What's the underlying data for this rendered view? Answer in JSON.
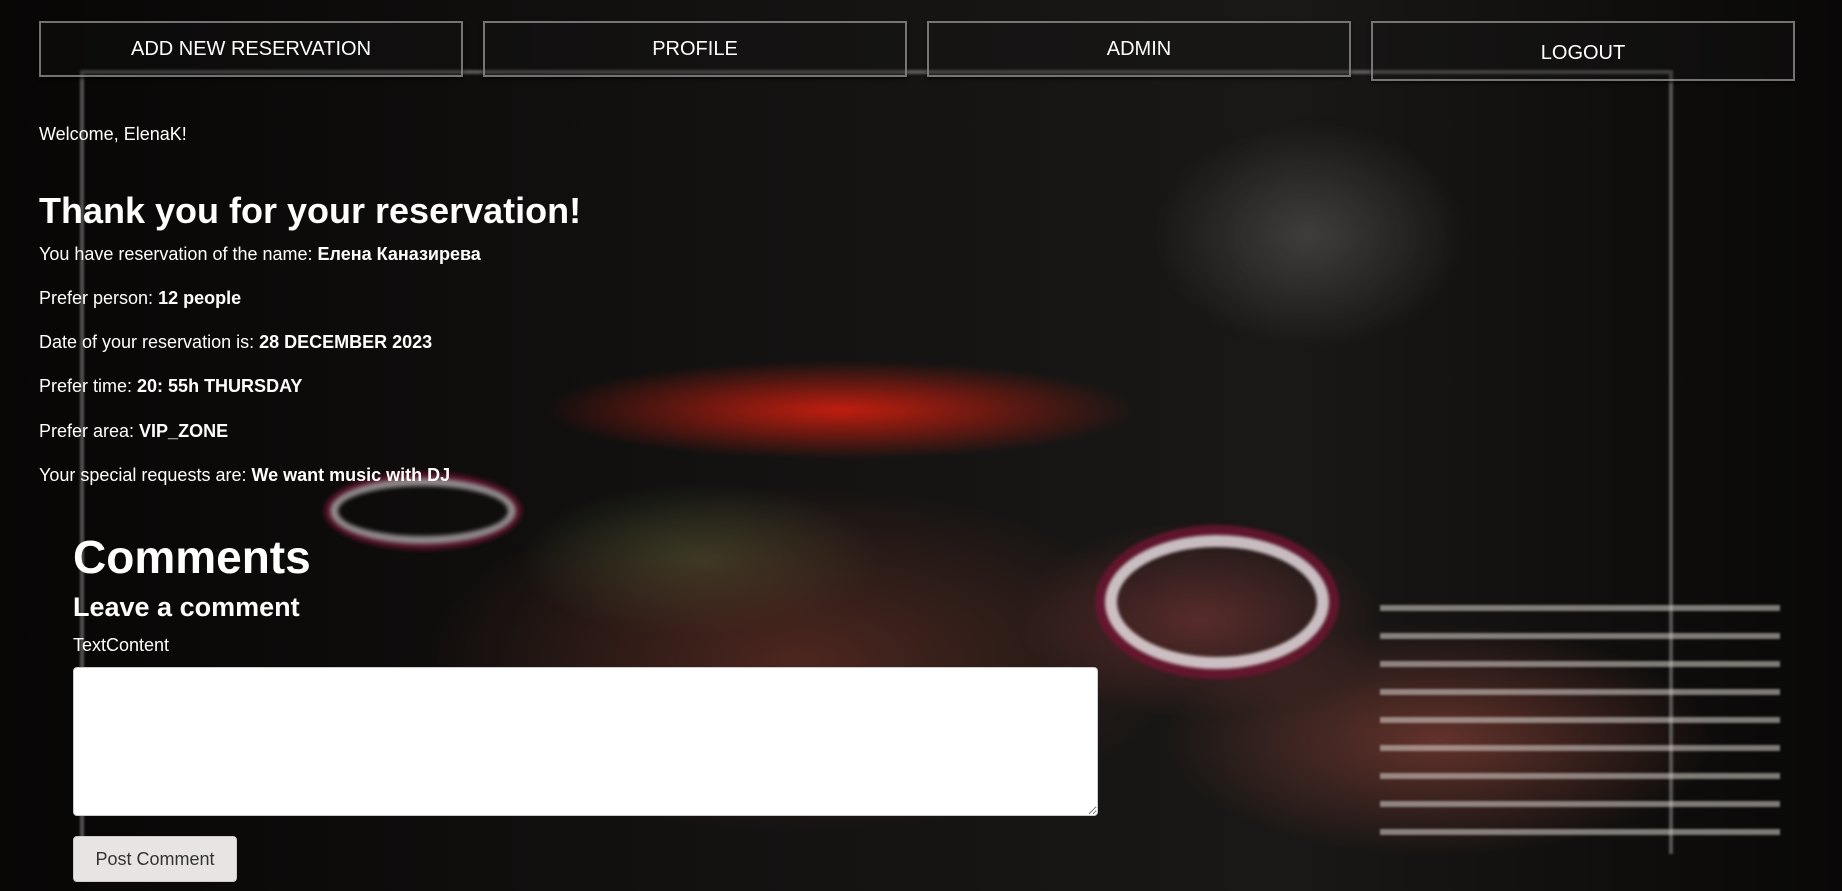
{
  "nav": {
    "add_reservation": "ADD NEW RESERVATION",
    "profile": "PROFILE",
    "admin": "ADMIN",
    "logout": "LOGOUT"
  },
  "welcome": "Welcome, ElenaK!",
  "title": "Thank you for your reservation!",
  "reservation": {
    "name_label": "You have reservation of the name: ",
    "name_value": "Елена Каназирева",
    "persons_label": "Prefer person: ",
    "persons_value": "12 people",
    "date_label": "Date of your reservation is: ",
    "date_value": "28 DECEMBER 2023",
    "time_label": "Prefer time: ",
    "time_value": "20: 55h THURSDAY",
    "area_label": "Prefer area: ",
    "area_value": "VIP_ZONE",
    "requests_label": "Your special requests are: ",
    "requests_value": "We want music with DJ"
  },
  "comments": {
    "heading": "Comments",
    "subheading": "Leave a comment",
    "field_label": "TextContent",
    "textarea_value": "",
    "submit_label": "Post Comment"
  },
  "colors": {
    "background": "#0a0807",
    "nav_border": "#969696",
    "button_bg": "#e9e4e4"
  }
}
